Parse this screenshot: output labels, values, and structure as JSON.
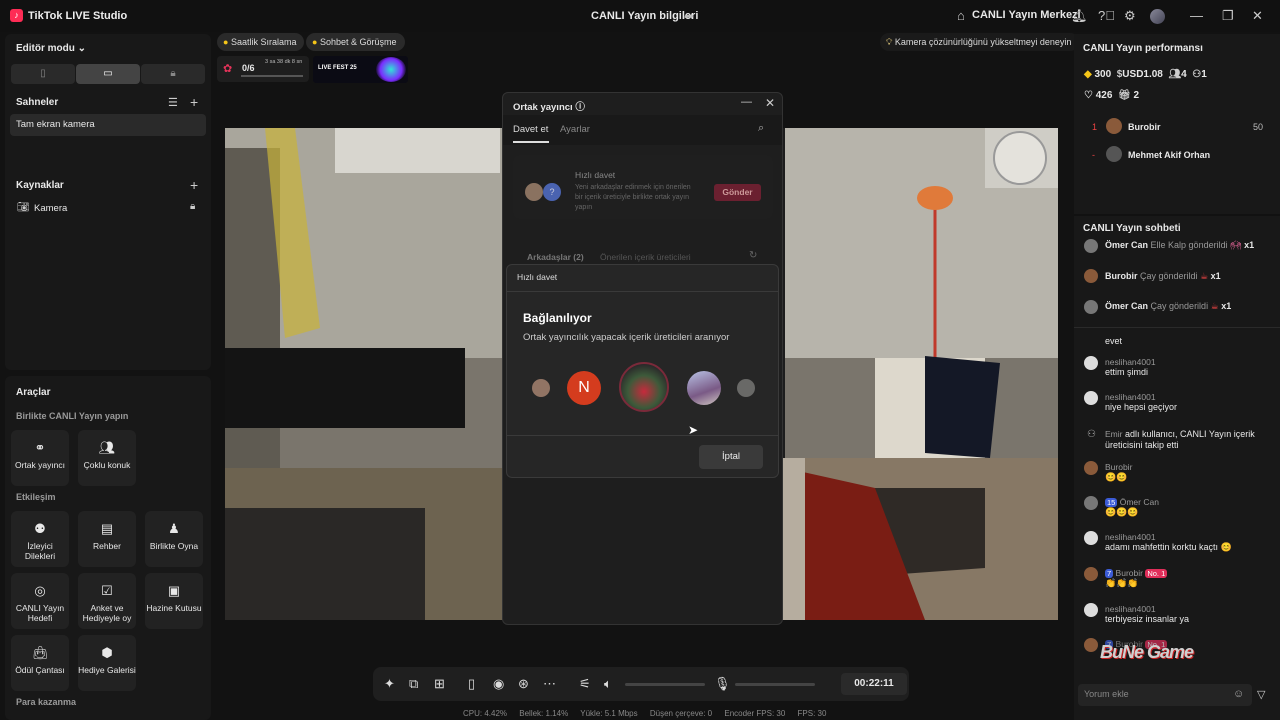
{
  "app": {
    "title": "TikTok LIVE Studio",
    "live_info": "CANLI Yayın bilgileri",
    "live_center": "CANLI Yayın Merkezi"
  },
  "left": {
    "editor_mode": "Editör modu",
    "scenes_title": "Sahneler",
    "scene_item": "Tam ekran kamera",
    "sources_title": "Kaynaklar",
    "source_item": "Kamera"
  },
  "tools": {
    "title": "Araçlar",
    "section_collab": "Birlikte CANLI Yayın yapın",
    "collab": [
      {
        "label": "Ortak yayıncı"
      },
      {
        "label": "Çoklu konuk"
      }
    ],
    "section_interaction": "Etkileşim",
    "interaction": [
      {
        "label": "İzleyici Dilekleri"
      },
      {
        "label": "Rehber"
      },
      {
        "label": "Birlikte Oyna"
      },
      {
        "label": "CANLI Yayın Hedefi"
      },
      {
        "label": "Anket ve Hediyeyle oy"
      },
      {
        "label": "Hazine Kutusu"
      },
      {
        "label": "Ödül Çantası"
      },
      {
        "label": "Hediye Galerisi"
      }
    ],
    "section_money": "Para kazanma"
  },
  "chips": {
    "hourly": "Saatlik Sıralama",
    "chat_meet": "Sohbet & Görüşme",
    "progress": "0/6",
    "timer_small": "3 sa 38 dk 8 sn",
    "fest": "LIVE FEST 25",
    "camera_tip": "Kamera çözünürlüğünü yükseltmeyi deneyin"
  },
  "cohost": {
    "title": "Ortak yayıncı",
    "tab_invite": "Davet et",
    "tab_settings": "Ayarlar",
    "quick_title": "Hızlı davet",
    "quick_desc": "Yeni arkadaşlar edinmek için önerilen bir içerik üreticiyle birlikte ortak yayın yapın",
    "send": "Gönder",
    "tab_friends": "Arkadaşlar (2)",
    "tab_suggested": "Önerilen içerik üreticileri"
  },
  "quick_dialog": {
    "header": "Hızlı davet",
    "heading": "Bağlanılıyor",
    "subtitle": "Ortak yayıncılık yapacak içerik üreticileri aranıyor",
    "initial": "N",
    "cancel": "İptal"
  },
  "right": {
    "perf_title": "CANLI Yayın performansı",
    "coins": "300",
    "usd": "USD1.08",
    "viewers": "4",
    "followers": "1",
    "likes": "426",
    "gifts": "2",
    "rank": [
      {
        "pos": "1",
        "name": "Burobir",
        "score": "50"
      },
      {
        "pos": "-",
        "name": "Mehmet Akif Orhan",
        "score": ""
      }
    ],
    "chat_title": "CANLI Yayın sohbeti",
    "gifts_list": [
      {
        "name": "Ömer Can",
        "text": "Elle Kalp gönderildi",
        "count": "x1"
      },
      {
        "name": "Burobir",
        "text": "Çay gönderildi",
        "count": "x1"
      },
      {
        "name": "Ömer Can",
        "text": "Çay gönderildi",
        "count": "x1"
      }
    ],
    "messages": [
      {
        "name": "",
        "text": "evet"
      },
      {
        "name": "neslihan4001",
        "text": "ettim şimdi"
      },
      {
        "name": "neslihan4001",
        "text": "niye hepsi geçiyor"
      },
      {
        "name": "Emir",
        "text": "adlı kullanıcı, CANLI Yayın içerik üreticisini takip etti"
      },
      {
        "name": "Burobir",
        "text": "😊😊"
      },
      {
        "name": "Ömer Can",
        "text": "😊😊😊",
        "badge": "15"
      },
      {
        "name": "neslihan4001",
        "text": "adamı mahfettin korktu kaçtı 😊"
      },
      {
        "name": "Burobir",
        "text": "👏👏👏",
        "badge": "7",
        "badge2": "No. 1"
      },
      {
        "name": "neslihan4001",
        "text": "terbiyesiz insanlar ya"
      },
      {
        "name": "Burobir",
        "text": "",
        "badge": "7",
        "badge2": "No. 1"
      }
    ],
    "comment_placeholder": "Yorum ekle",
    "watermark": "BuNe Game"
  },
  "bottom": {
    "timer": "00:22:11",
    "stats": [
      "CPU: 4.42%",
      "Bellek: 1.14%",
      "Yükle: 5.1 Mbps",
      "Düşen çerçeve: 0",
      "Encoder FPS: 30",
      "FPS: 30"
    ]
  }
}
